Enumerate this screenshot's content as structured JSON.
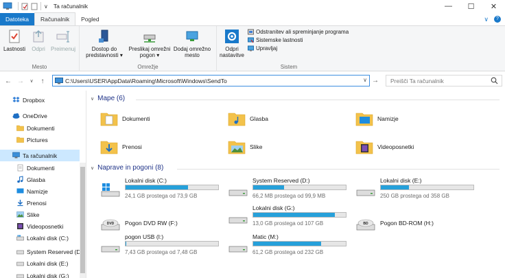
{
  "window": {
    "title": "Ta računalnik",
    "controls": [
      "—",
      "☐",
      "✕"
    ]
  },
  "ribbon_tabs": [
    {
      "label": "Datoteka"
    },
    {
      "label": "Računalnik"
    },
    {
      "label": "Pogled"
    }
  ],
  "ribbon": {
    "groups": {
      "mesto": {
        "label": "Mesto",
        "buttons": [
          {
            "label": "Lastnosti",
            "icon": "check-properties-icon"
          },
          {
            "label": "Odpri",
            "icon": "open-icon"
          },
          {
            "label": "Preimenuj",
            "icon": "rename-icon"
          }
        ]
      },
      "omrezje": {
        "label": "Omrežje",
        "buttons": [
          {
            "label": "Dostop do predstavnosti ▾",
            "icon": "media-server-icon"
          },
          {
            "label": "Preslikaj omrežni pogon ▾",
            "icon": "map-drive-icon"
          },
          {
            "label": "Dodaj omrežno mesto",
            "icon": "network-location-icon"
          }
        ]
      },
      "sistem": {
        "label": "Sistem",
        "big_button": {
          "label": "Odpri nastavitve",
          "icon": "gear-icon"
        },
        "small_buttons": [
          {
            "label": "Odstranitev ali spreminjanje programa",
            "icon": "uninstall-icon"
          },
          {
            "label": "Sistemske lastnosti",
            "icon": "system-properties-icon"
          },
          {
            "label": "Upravljaj",
            "icon": "manage-icon"
          }
        ]
      }
    }
  },
  "address_bar": {
    "path": "C:\\Users\\USER\\AppData\\Roaming\\Microsoft\\Windows\\SendTo",
    "search_placeholder": "Preišči Ta računalnik"
  },
  "sidebar": {
    "items": [
      {
        "label": "Dropbox",
        "icon": "dropbox-icon"
      },
      {
        "label": "OneDrive",
        "icon": "onedrive-icon"
      },
      {
        "label": "Dokumenti",
        "icon": "folder-icon"
      },
      {
        "label": "Pictures",
        "icon": "folder-icon"
      },
      {
        "label": "Ta računalnik",
        "icon": "computer-icon"
      },
      {
        "label": "Dokumenti",
        "icon": "documents-icon"
      },
      {
        "label": "Glasba",
        "icon": "music-icon"
      },
      {
        "label": "Namizje",
        "icon": "desktop-icon"
      },
      {
        "label": "Prenosi",
        "icon": "downloads-icon"
      },
      {
        "label": "Slike",
        "icon": "pictures-icon"
      },
      {
        "label": "Videoposnetki",
        "icon": "videos-icon"
      },
      {
        "label": "Lokalni disk (C:)",
        "icon": "drive-icon"
      },
      {
        "label": "System Reserved (D:)",
        "icon": "drive-icon"
      },
      {
        "label": "Lokalni disk (E:)",
        "icon": "drive-icon"
      },
      {
        "label": "Lokalni disk (G:)",
        "icon": "drive-icon"
      }
    ],
    "selected_index": 4
  },
  "folders_section": {
    "header": "Mape (6)",
    "items": [
      {
        "label": "Dokumenti",
        "icon": "documents-folder-icon"
      },
      {
        "label": "Glasba",
        "icon": "music-folder-icon"
      },
      {
        "label": "Namizje",
        "icon": "desktop-folder-icon"
      },
      {
        "label": "Prenosi",
        "icon": "downloads-folder-icon"
      },
      {
        "label": "Slike",
        "icon": "pictures-folder-icon"
      },
      {
        "label": "Videoposnetki",
        "icon": "videos-folder-icon"
      }
    ]
  },
  "drives_section": {
    "header": "Naprave in pogoni (8)",
    "items": [
      {
        "label": "Lokalni disk (C:)",
        "size": "24,1 GB prostega od 73,9 GB",
        "used_fraction": 0.674,
        "icon": "windows-drive-icon"
      },
      {
        "label": "System Reserved (D:)",
        "size": "66,2 MB prostega od 99,9 MB",
        "used_fraction": 0.337,
        "icon": "drive-icon"
      },
      {
        "label": "Lokalni disk (E:)",
        "size": "250 GB prostega od 358 GB",
        "used_fraction": 0.302,
        "icon": "drive-icon"
      },
      {
        "label": "Pogon DVD RW (F:)",
        "size": "",
        "used_fraction": null,
        "icon": "dvd-drive-icon",
        "badge": "DVD"
      },
      {
        "label": "Lokalni disk (G:)",
        "size": "13,0 GB prostega od 107 GB",
        "used_fraction": 0.879,
        "icon": "drive-icon"
      },
      {
        "label": "Pogon BD-ROM (H:)",
        "size": "",
        "used_fraction": null,
        "icon": "bd-drive-icon",
        "badge": "BD"
      },
      {
        "label": "pogon USB (I:)",
        "size": "7,43 GB prostega od 7,48 GB",
        "used_fraction": 0.007,
        "icon": "usb-drive-icon"
      },
      {
        "label": "Matic (M:)",
        "size": "61,2 GB prostega od 232 GB",
        "used_fraction": 0.736,
        "icon": "drive-icon"
      }
    ]
  },
  "colors": {
    "accent": "#1979ca",
    "bar_fill": "#26a0da",
    "selection": "#cce8ff",
    "section_header": "#1e3287"
  }
}
